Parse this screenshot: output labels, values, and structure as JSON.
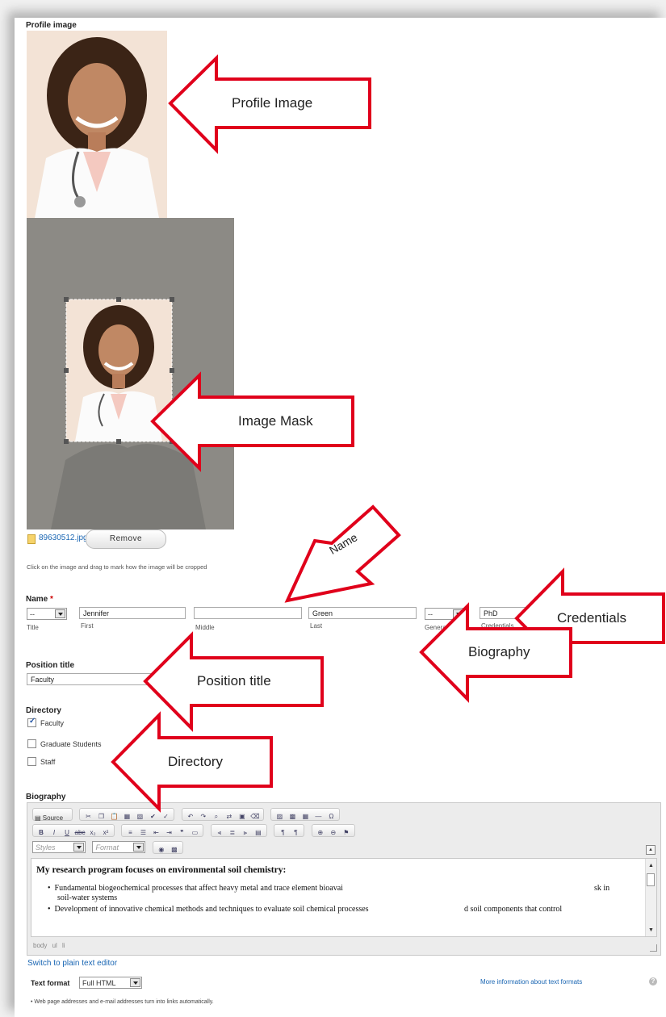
{
  "profile_image": {
    "label": "Profile image"
  },
  "file": {
    "name": "89630512.jpg",
    "remove_label": "Remove",
    "crop_help": "Click on the image and drag to mark how the image will be cropped"
  },
  "name_section": {
    "label": "Name",
    "required_mark": "*",
    "title": {
      "value": "--",
      "sublabel": "Title"
    },
    "first": {
      "value": "Jennifer",
      "sublabel": "First"
    },
    "middle": {
      "value": "",
      "sublabel": "Middle"
    },
    "last": {
      "value": "Green",
      "sublabel": "Last"
    },
    "generational": {
      "value": "--",
      "sublabel": "Generational"
    },
    "credentials": {
      "value": "PhD",
      "sublabel": "Credentials"
    }
  },
  "position": {
    "label": "Position title",
    "value": "Faculty"
  },
  "directory": {
    "label": "Directory",
    "items": [
      {
        "label": "Faculty",
        "checked": true
      },
      {
        "label": "Graduate Students",
        "checked": false
      },
      {
        "label": "Staff",
        "checked": false
      }
    ]
  },
  "biography": {
    "label": "Biography",
    "toolbar": {
      "source_label": "Source",
      "styles_label": "Styles",
      "format_label": "Format"
    },
    "heading": "My research program focuses on environmental soil chemistry:",
    "bullets": [
      {
        "text": "Fundamental biogeochemical processes that affect heavy metal and trace element bioavai",
        "tail": "sk in",
        "line2": "soil-water systems"
      },
      {
        "text": "Development of innovative chemical methods and techniques to evaluate soil chemical processes",
        "tail": "d soil components that control",
        "line2": ""
      }
    ],
    "status_path": "body  ul  li"
  },
  "switch_editor": "Switch to plain text editor",
  "text_format": {
    "label": "Text format",
    "value": "Full HTML",
    "more_info": "More information about text formats",
    "tip": "Web page addresses and e-mail addresses turn into links automatically."
  },
  "callouts": {
    "profile_image": "Profile Image",
    "image_mask": "Image Mask",
    "name": "Name",
    "credentials": "Credentials",
    "position_title": "Position title",
    "directory": "Directory",
    "biography": "Biography"
  },
  "colors": {
    "callout_stroke": "#e0001b",
    "link": "#1a66b3",
    "required": "#cc0000",
    "crop_background": "#8c8a85"
  }
}
